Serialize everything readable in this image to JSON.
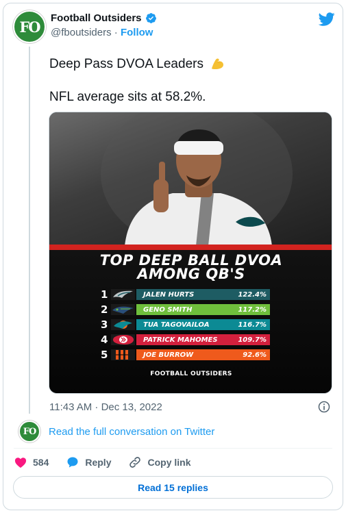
{
  "author": {
    "name": "Football Outsiders",
    "handle": "@fboutsiders",
    "separator": "·",
    "follow_label": "Follow",
    "avatar_text": "FO"
  },
  "tweet": {
    "line1": "Deep Pass DVOA Leaders",
    "line2": "NFL average sits at 58.2%."
  },
  "graphic": {
    "headline_line1": "TOP DEEP BALL DVOA",
    "headline_line2": "AMONG QB'S",
    "rows": [
      {
        "rank": "1",
        "name": "JALEN HURTS",
        "value": "122.4%",
        "color": "#1e5c63",
        "team_icon": "eagles-logo-icon"
      },
      {
        "rank": "2",
        "name": "GENO SMITH",
        "value": "117.2%",
        "color": "#6fbf3c",
        "team_icon": "seahawks-logo-icon"
      },
      {
        "rank": "3",
        "name": "TUA TAGOVAILOA",
        "value": "116.7%",
        "color": "#0c8a94",
        "team_icon": "dolphins-logo-icon"
      },
      {
        "rank": "4",
        "name": "PATRICK MAHOMES",
        "value": "109.7%",
        "color": "#d3203d",
        "team_icon": "chiefs-logo-icon"
      },
      {
        "rank": "5",
        "name": "JOE BURROW",
        "value": "92.6%",
        "color": "#ef5a1c",
        "team_icon": "bengals-logo-icon"
      }
    ],
    "footer_brand": "FOOTBALL OUTSIDERS"
  },
  "meta": {
    "timestamp": "11:43 AM · Dec 13, 2022"
  },
  "conversation": {
    "link_text": "Read the full conversation on Twitter"
  },
  "actions": {
    "like_count": "584",
    "reply_label": "Reply",
    "copy_label": "Copy link"
  },
  "replies_button": "Read 15 replies",
  "colors": {
    "twitter_blue": "#1d9bf0",
    "like_red": "#f91880",
    "brand_green": "#2e8b3a",
    "graphic_red": "#d2231f"
  }
}
